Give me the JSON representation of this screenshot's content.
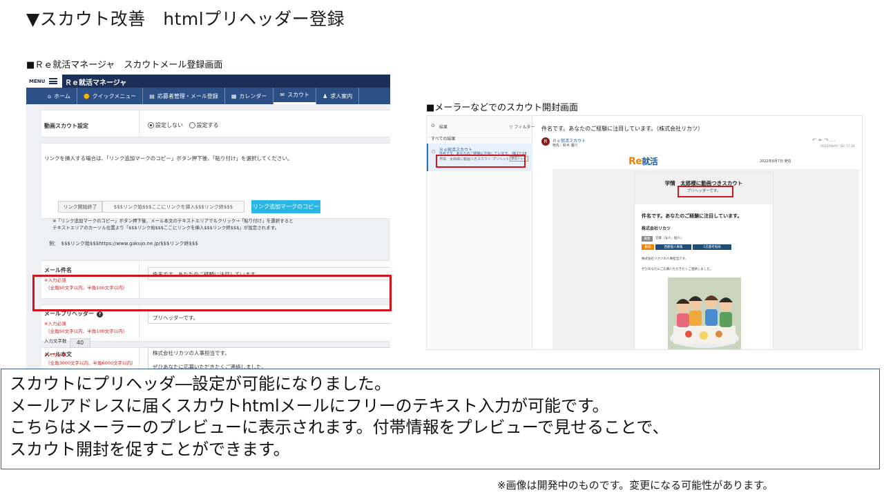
{
  "slide": {
    "title": "▼スカウト改善　htmlプリヘッダー登録",
    "left_caption": "■Ｒｅ就活マネージャ　スカウトメール登録画面",
    "right_caption": "■メーラーなどでのスカウト開封画面",
    "description": [
      "スカウトにプリヘッダ―設定が可能になりました。",
      "メールアドレスに届くスカウトhtmlメールにフリーのテキスト入力が可能です。",
      "こちらはメーラーのプレビューに表示されます。付帯情報をプレビューで見せることで、",
      "スカウト開封を促すことができます。"
    ],
    "disclaimer": "※画像は開発中のものです。変更になる可能性があります。"
  },
  "admin": {
    "menu_label": "MENU",
    "brand": "Ｒｅ就活マネージャ",
    "nav": [
      {
        "icon": "home-icon",
        "label": "ホーム"
      },
      {
        "icon": "quick-menu-icon",
        "label": "クイックメニュー"
      },
      {
        "icon": "applicant-icon",
        "label": "応募者管理・メール登録"
      },
      {
        "icon": "calendar-icon",
        "label": "カレンダー"
      },
      {
        "icon": "mail-icon",
        "label": "スカウト"
      },
      {
        "icon": "users-icon",
        "label": "求人案内"
      }
    ],
    "video_scout": {
      "label": "動画スカウト設定",
      "option_off": "設定しない",
      "option_on": "設定する",
      "selected": "設定しない"
    },
    "link_help": "リンクを挿入する場合は、「リンク追加マークのコピー」ボタン押下後、「貼り付け」を選択してください。",
    "link_tabs": [
      "リンク開始終了",
      "$$$リンク始$$$ここにリンクを挿入$$$リンク終$$$"
    ],
    "link_copy_button": "リンク追加マークのコピー",
    "link_note_1": "※「リンク追加マークのコピー」ボタン押下後、メール本文のテキストエリアでもクリック→「貼り付け」を選択すると",
    "link_note_2": "テキストエリアのカーソル位置より「$$$リンク始$$$ここにリンクを挿入$$$リンク終$$$」が設定されます。",
    "link_example": "例：　$$$リンク始$$$https://www.gakujo.ne.jp/$$$リンク終$$$",
    "subject": {
      "label": "メール件名",
      "required": "※入力必須",
      "limit": "（全角50文字以内、半角100文字以内）",
      "value": "件名です。あなたのご経験に注目しています。"
    },
    "preheader": {
      "label": "メールプリヘッダー",
      "required": "※入力必須",
      "limit": "（全角50文字以内、半角100文字以内）",
      "value": "プリヘッダーです。"
    },
    "body": {
      "label": "メール本文",
      "count_label": "入力文字数",
      "count": "40",
      "required": "※入力必須",
      "limit": "（全角3000文字以内、半角6000文字以内）",
      "line1": "株式会社リカツの人事担当です。",
      "line2": "ぜひあなたに応募いただきたくご連絡しました。"
    }
  },
  "mail": {
    "list_title": "結果",
    "filter_label": "フィルター",
    "all_results": "すべての結果",
    "item_sender": "Ｒｅ就活スカウト",
    "item_subject": "件名です。あなたのご経験に注目しています。（株式",
    "item_time": "17:18",
    "item_preview": "学情　太郎様に動画つきスカウト プリヘッダー...",
    "item_badge": "受信トレイ",
    "subject": "件名です。あなたのご経験に注目しています。（株式会社リカツ）",
    "avatar_letter": "R",
    "from": "Ｒｅ就活スカウト",
    "to": "宛先：鈴木 優介",
    "datetime": "2022/08/07 (日) 17:18",
    "logo_main": "Re",
    "logo_sub": "就活",
    "send_date": "2022年8月7日 発信",
    "card_title": "学情　太郎様に動画つきスカウト",
    "card_preheader": "プリヘッダーです。",
    "card_subject": "件名です。あなたのご経験に注目しています。",
    "company": "株式会社リカツ",
    "tag1": "募集",
    "tag1_value": "営業（法人、個人）",
    "tag2": "勤務",
    "tag3": "西暦個人事業",
    "tag4": "1次選考免除",
    "body1": "株式会社リカツの人事担当です。",
    "body2": "ぜひあなたにご応募いただきたくご連絡しました。",
    "colors": {
      "logo_orange": "#f08300",
      "logo_blue": "#1f5aa5",
      "tag_navy": "#1f4e79",
      "tag_orange": "#f08300"
    }
  },
  "colors": {
    "highlight_red": "#d4141b",
    "nav_blue": "#2c4f85",
    "topbar_navy": "#1c2f57",
    "copy_button": "#2ab6e6"
  }
}
